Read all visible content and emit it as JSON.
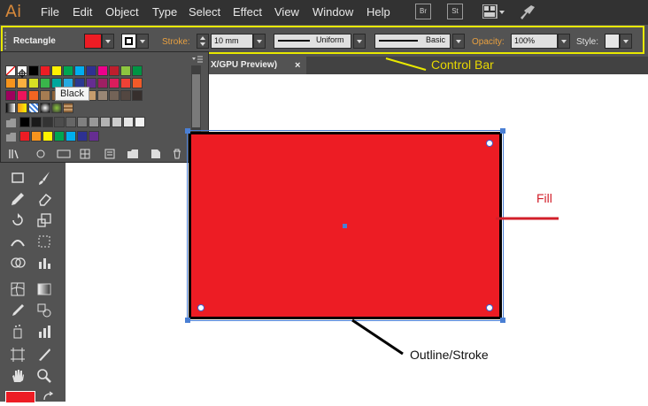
{
  "app": {
    "logo": "Ai"
  },
  "menu": [
    "File",
    "Edit",
    "Object",
    "Type",
    "Select",
    "Effect",
    "View",
    "Window",
    "Help"
  ],
  "toolbar_icons": [
    "Br",
    "St"
  ],
  "control_bar": {
    "selection": "Rectangle",
    "stroke_label": "Stroke:",
    "stroke_weight": "10 mm",
    "stroke_profile": "Uniform",
    "brush": "Basic",
    "opacity_label": "Opacity:",
    "opacity_value": "100%",
    "style_label": "Style:"
  },
  "document_tab": {
    "title": "X/GPU Preview)",
    "close": "×"
  },
  "swatches": {
    "tooltip": "Black",
    "row1": [
      "#ffffff",
      "#ffffff",
      "#000000",
      "#ed1c24",
      "#fff200",
      "#00a651",
      "#00aeef",
      "#2e3192",
      "#ec008c",
      "#be1e2d",
      "#8dc63f",
      "#009444"
    ],
    "row2": [
      "#f7941d",
      "#fbb040",
      "#d7df23",
      "#39b54a",
      "#00a79d",
      "#27aae1",
      "#2b3990",
      "#662d91",
      "#9e1f63",
      "#da1c5c",
      "#ef4136",
      "#f15a29"
    ],
    "row3": [
      "#9e005d",
      "#ed145b",
      "#f26522",
      "#a67c52",
      "#8c6239",
      "#754c24",
      "#603813",
      "#c69c6d",
      "#998675",
      "#736357",
      "#534741",
      "#362f2d"
    ],
    "row5": [
      "#000000",
      "#1a1a1a",
      "#333333",
      "#4d4d4d",
      "#666666",
      "#808080",
      "#999999",
      "#b3b3b3",
      "#cccccc",
      "#e6e6e6",
      "#f2f2f2"
    ],
    "row6": [
      "#ed1c24",
      "#f7941d",
      "#fff200",
      "#00a651",
      "#00aeef",
      "#2e3192",
      "#662d91"
    ]
  },
  "annotations": {
    "control_bar": "Control Bar",
    "fill": "Fill",
    "outline": "Outline/Stroke"
  },
  "colors": {
    "fill": "#ed1c24",
    "stroke": "#000000",
    "highlight": "#e8e800",
    "annotation_line_fill": "#d21f2a",
    "annotation_line_stroke": "#000000"
  }
}
